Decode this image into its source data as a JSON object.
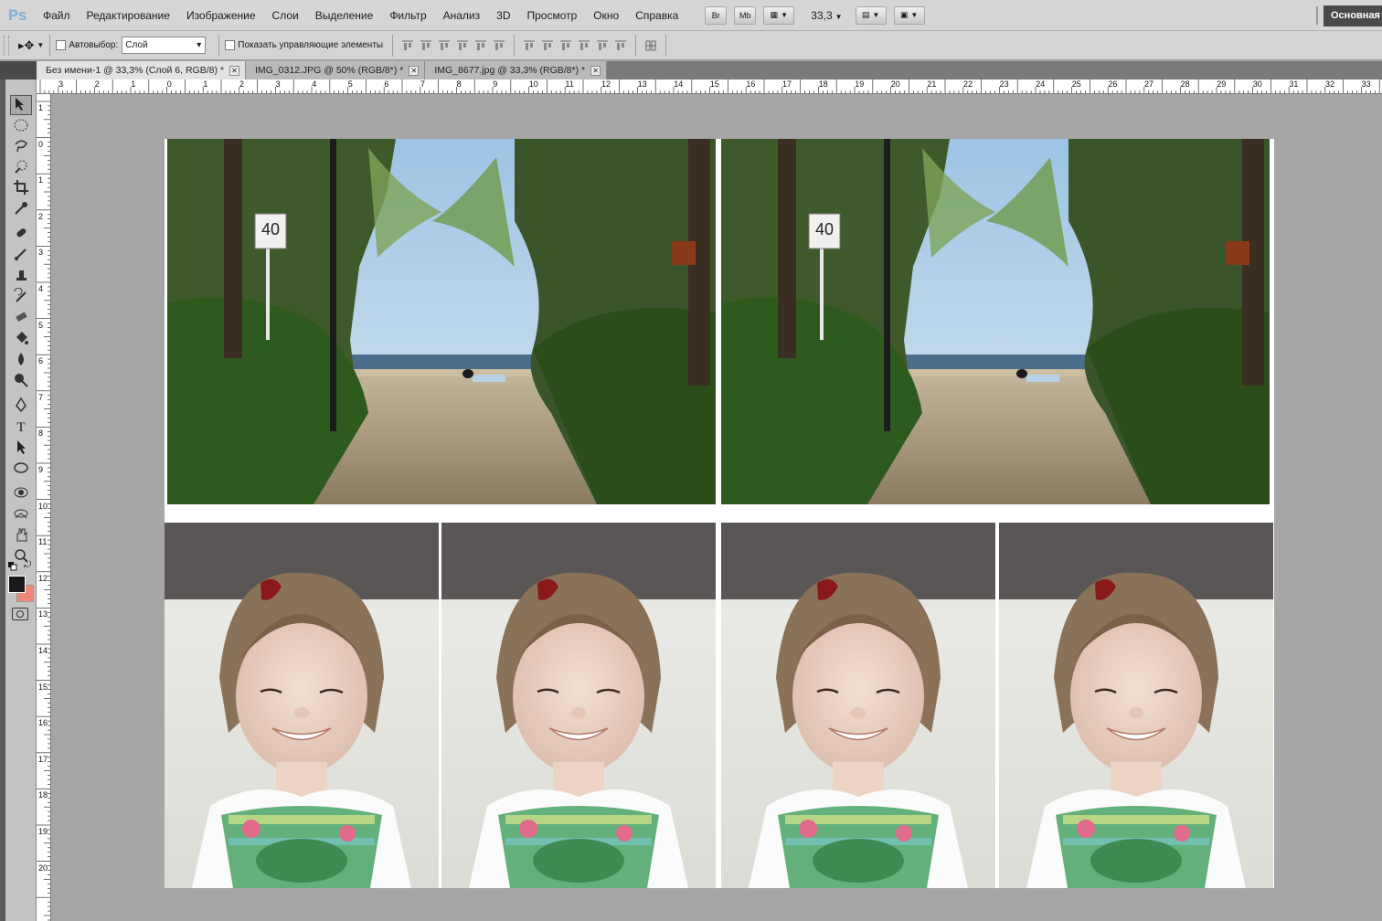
{
  "app": {
    "logo": "Ps"
  },
  "menu": [
    "Файл",
    "Редактирование",
    "Изображение",
    "Слои",
    "Выделение",
    "Фильтр",
    "Анализ",
    "3D",
    "Просмотр",
    "Окно",
    "Справка"
  ],
  "menubar_buttons": {
    "bridge": "Br",
    "mini_bridge": "Mb"
  },
  "zoom": "33,3",
  "workspace": "Основная",
  "options": {
    "autoselect_label": "Автовыбор:",
    "autoselect_value": "Слой",
    "show_controls_label": "Показать управляющие элементы"
  },
  "tabs": [
    {
      "label": "Без имени-1 @ 33,3% (Слой 6, RGB/8) *",
      "active": true
    },
    {
      "label": "IMG_0312.JPG @ 50% (RGB/8*) *",
      "active": false
    },
    {
      "label": "IMG_8677.jpg @ 33,3% (RGB/8*) *",
      "active": false
    }
  ],
  "ruler_top_labels": [
    "3",
    "2",
    "1",
    "0",
    "1",
    "2",
    "3",
    "4",
    "5",
    "6",
    "7",
    "8",
    "9",
    "10",
    "11",
    "12",
    "13",
    "14",
    "15",
    "16",
    "17",
    "18",
    "19",
    "20",
    "21",
    "22",
    "23",
    "24",
    "25",
    "26",
    "27",
    "28",
    "29",
    "30",
    "31",
    "32",
    "33"
  ],
  "ruler_left_labels": [
    "1",
    "0",
    "1",
    "2",
    "3",
    "4",
    "5",
    "6",
    "7",
    "8",
    "9",
    "10",
    "11",
    "12",
    "13",
    "14",
    "15",
    "16",
    "17",
    "18",
    "19",
    "20"
  ],
  "colors": {
    "foreground": "#1a1a1a",
    "background": "#f08878"
  },
  "photos": {
    "landscape_sign": "40"
  }
}
